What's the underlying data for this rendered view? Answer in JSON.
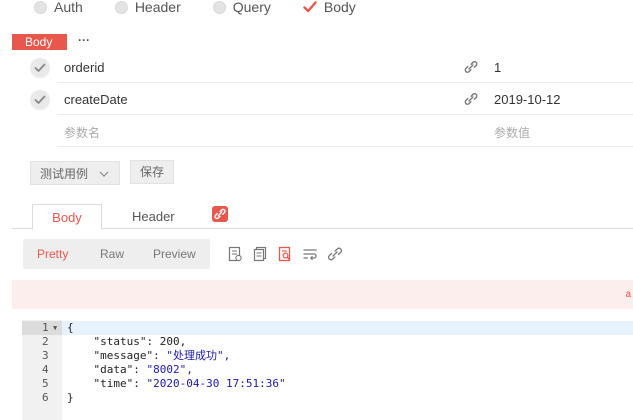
{
  "auth_options": [
    {
      "label": "Auth",
      "checked": false
    },
    {
      "label": "Header",
      "checked": false
    },
    {
      "label": "Query",
      "checked": false
    },
    {
      "label": "Body",
      "checked": true
    }
  ],
  "body_section": {
    "badge": "Body",
    "more": "···"
  },
  "params": [
    {
      "key": "orderid",
      "value": "1"
    },
    {
      "key": "createDate",
      "value": "2019-10-12"
    }
  ],
  "param_placeholders": {
    "key": "参数名",
    "value": "参数值"
  },
  "buttons": {
    "test_case": "测试用例",
    "save": "保存"
  },
  "response_tabs": {
    "body": "Body",
    "header": "Header"
  },
  "view_modes": {
    "pretty": "Pretty",
    "raw": "Raw",
    "preview": "Preview"
  },
  "pink_bar_edge": "a",
  "code": {
    "line_numbers": [
      "1",
      "2",
      "3",
      "4",
      "5",
      "6"
    ],
    "lines": [
      "{",
      "    \"status\": 200,",
      "    \"message\": \"处理成功\",",
      "    \"data\": \"8002\",",
      "    \"time\": \"2020-04-30 17:51:36\"",
      "}"
    ]
  },
  "colors": {
    "accent": "#e8574c",
    "badge_bg": "#e8574c",
    "pink_bar": "#fdeeee"
  }
}
